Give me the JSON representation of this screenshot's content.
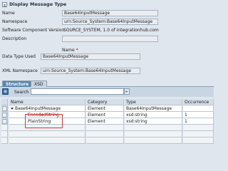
{
  "window": {
    "title": "Display Message Type"
  },
  "form": {
    "name": {
      "label": "Name",
      "value": "Base64InputMessage"
    },
    "namespace": {
      "label": "Namespace",
      "value": "urn:Source_System:Base64InputMessage"
    },
    "software_component_version": {
      "label": "Software Component Version",
      "value": "SOURCE_SYSTEM, 1.0 of integrationhub.com"
    },
    "description": {
      "label": "Description",
      "value": ""
    },
    "name_header": {
      "label": "Name",
      "required_mark": "*"
    },
    "data_type_used": {
      "label": "Data Type Used",
      "value": "Base64InputMessage"
    },
    "xml_namespace": {
      "label": "XML Namespace",
      "value": "urn:Source_System:Base64InputMessage"
    }
  },
  "tabs": [
    {
      "label": "Structure",
      "active": true
    },
    {
      "label": "XSD",
      "active": false
    }
  ],
  "toolbar": {
    "button_icon": "table-settings-icon",
    "search_label": "Search",
    "search_value": "",
    "search_button_icon": "search-arrow-icon"
  },
  "grid": {
    "columns": [
      "Name",
      "Category",
      "Type",
      "Occurrence"
    ],
    "rows": [
      {
        "name": "Base64InputMessage",
        "category": "Element",
        "type": "Base64InputMessage",
        "occurrence": "",
        "expanded": true
      },
      {
        "name": "EncodedString",
        "category": "Element",
        "type": "xsd:string",
        "occurrence": "1",
        "highlighted": true
      },
      {
        "name": "PlainString",
        "category": "Element",
        "type": "xsd:string",
        "occurrence": "1",
        "highlighted": true
      }
    ]
  },
  "colors": {
    "highlight": "#e03030",
    "active_tab": "#5b86ad",
    "background": "#dfe6ee"
  }
}
